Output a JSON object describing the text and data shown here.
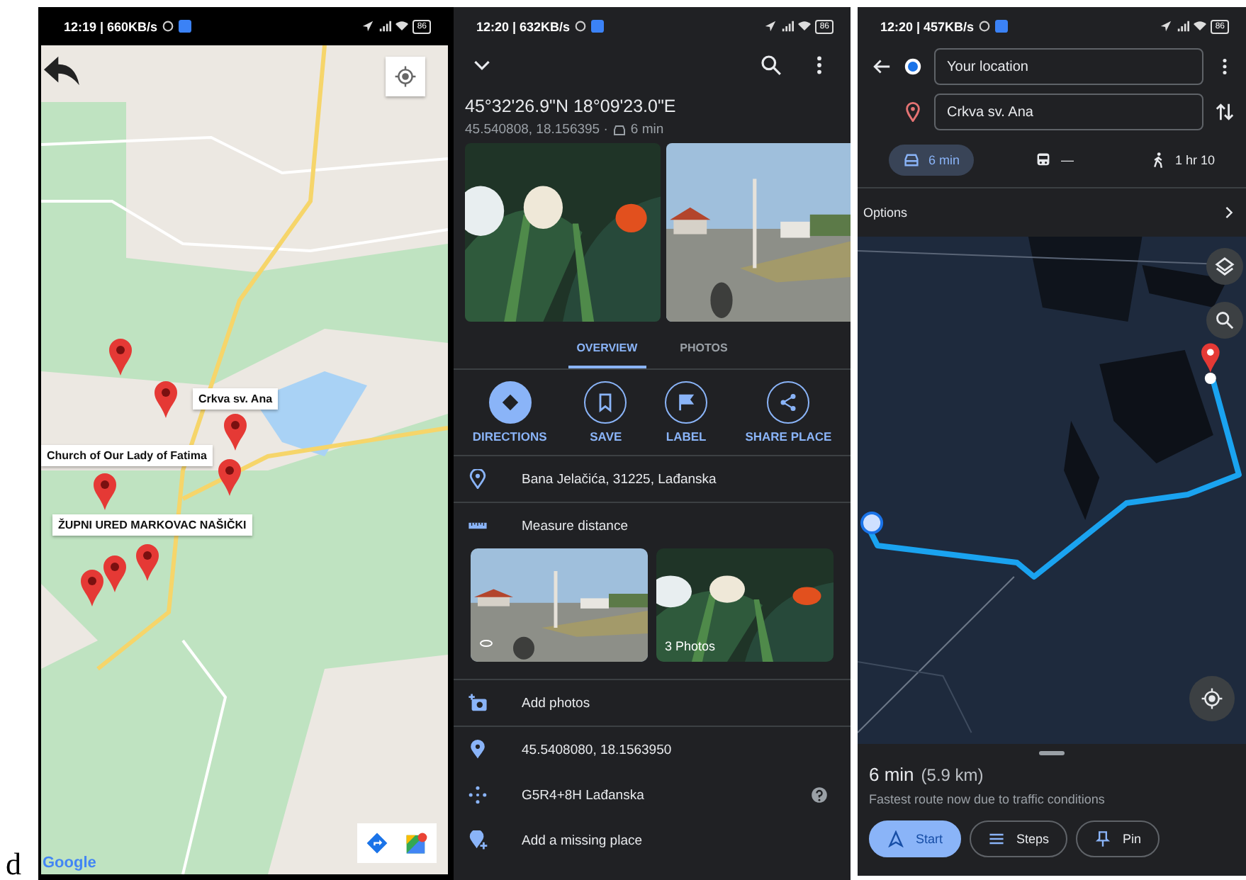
{
  "figure_label": "d",
  "map_screen": {
    "status_bar": {
      "time": "12:19 | 660KB/s",
      "battery": "86"
    },
    "marker_labels": [
      "Crkva sv. Ana",
      "Church of Our Lady of Fatima",
      "ŽUPNI URED MARKOVAC NAŠIČKI"
    ],
    "logo": "Google"
  },
  "place_screen": {
    "status_bar": {
      "time": "12:20 | 632KB/s",
      "battery": "86"
    },
    "title": "45°32'26.9\"N 18°09'23.0\"E",
    "coordinates": "45.540808, 18.156395 ·",
    "drive_time": "6 min",
    "tabs": [
      {
        "label": "OVERVIEW",
        "selected": true
      },
      {
        "label": "PHOTOS",
        "selected": false
      }
    ],
    "actions": [
      {
        "kind": "directions",
        "label": "DIRECTIONS",
        "primary": true
      },
      {
        "kind": "save",
        "label": "SAVE",
        "primary": false
      },
      {
        "kind": "label",
        "label": "LABEL",
        "primary": false
      },
      {
        "kind": "share",
        "label": "SHARE PLACE",
        "primary": false
      }
    ],
    "rows": [
      {
        "kind": "address",
        "text": "Bana Jelačića, 31225, Lađanska"
      },
      {
        "kind": "measure",
        "text": "Measure distance"
      },
      {
        "kind": "photos",
        "caption": "3 Photos"
      },
      {
        "kind": "add_photos",
        "text": "Add photos"
      },
      {
        "kind": "coordinates",
        "text": "45.5408080, 18.1563950"
      },
      {
        "kind": "plus_code",
        "text": "G5R4+8H Lađanska",
        "help": true
      },
      {
        "kind": "add_place",
        "text": "Add a missing place"
      }
    ]
  },
  "directions_screen": {
    "status_bar": {
      "time": "12:20 | 457KB/s",
      "battery": "86"
    },
    "origin": "Your location",
    "destination": "Crkva sv. Ana",
    "modes": [
      {
        "kind": "car",
        "text": "6 min",
        "selected": true
      },
      {
        "kind": "transit",
        "text": "—",
        "selected": false
      },
      {
        "kind": "walk",
        "text": "1 hr 10",
        "selected": false
      }
    ],
    "options": "Options",
    "duration": "6 min",
    "distance": "(5.9 km)",
    "note": "Fastest route now due to traffic conditions",
    "buttons": [
      {
        "kind": "start",
        "label": "Start",
        "primary": true
      },
      {
        "kind": "steps",
        "label": "Steps",
        "primary": false
      },
      {
        "kind": "pin",
        "label": "Pin",
        "primary": false
      }
    ]
  }
}
